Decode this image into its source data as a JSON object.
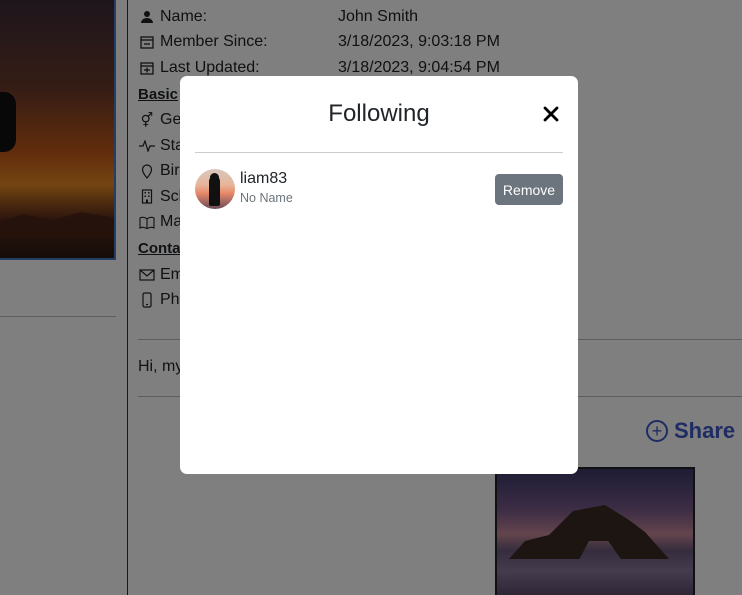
{
  "profile": {
    "fields": [
      {
        "icon": "person-icon",
        "label": "Name:",
        "value": "John Smith"
      },
      {
        "icon": "calendar-minus-icon",
        "label": "Member Since:",
        "value": "3/18/2023, 9:03:18 PM"
      },
      {
        "icon": "calendar-plus-icon",
        "label": "Last Updated:",
        "value": "3/18/2023, 9:04:54 PM"
      }
    ],
    "basic_heading": "Basic",
    "basic_rows": [
      {
        "icon": "gender-icon",
        "label": "Ge"
      },
      {
        "icon": "activity-icon",
        "label": "Sta"
      },
      {
        "icon": "pin-icon",
        "label": "Bir"
      },
      {
        "icon": "building-icon",
        "label": "Sch"
      },
      {
        "icon": "book-icon",
        "label": "Ma"
      }
    ],
    "contact_heading": "Conta",
    "contact_rows": [
      {
        "icon": "envelope-icon",
        "label": "Em"
      },
      {
        "icon": "phone-icon",
        "label": "Ph"
      }
    ],
    "bio": "Hi, my",
    "share_label": "Share a"
  },
  "modal": {
    "title": "Following",
    "close_icon": "close-icon",
    "items": [
      {
        "username": "liam83",
        "fullname": "No Name",
        "action": "Remove"
      }
    ]
  },
  "colors": {
    "accent": "#3f57c6",
    "remove_button": "#6c757d",
    "backdrop": "rgba(0,0,0,0.5)"
  }
}
